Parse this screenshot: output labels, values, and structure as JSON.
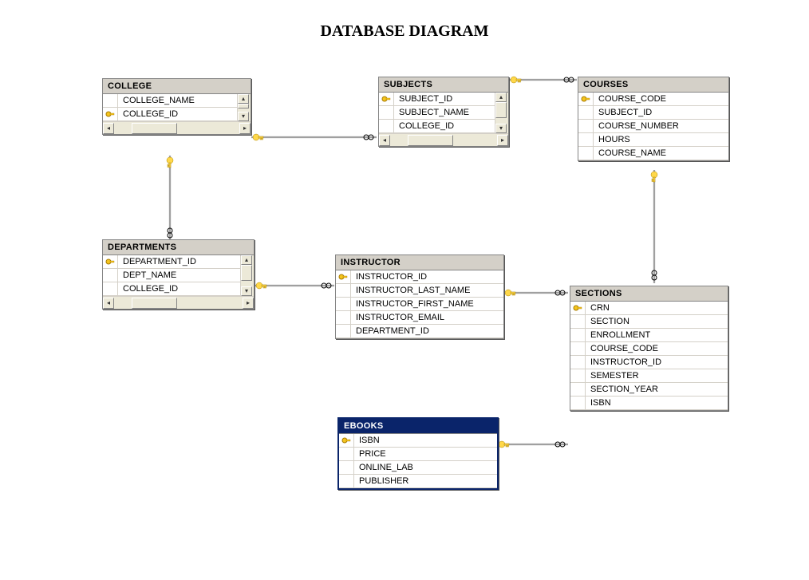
{
  "title": "DATABASE DIAGRAM",
  "tables": {
    "college": {
      "name": "COLLEGE",
      "columns": [
        {
          "name": "COLLEGE_NAME",
          "pk": false
        },
        {
          "name": "COLLEGE_ID",
          "pk": true
        }
      ]
    },
    "subjects": {
      "name": "SUBJECTS",
      "columns": [
        {
          "name": "SUBJECT_ID",
          "pk": true
        },
        {
          "name": "SUBJECT_NAME",
          "pk": false
        },
        {
          "name": "COLLEGE_ID",
          "pk": false
        }
      ]
    },
    "courses": {
      "name": "COURSES",
      "columns": [
        {
          "name": "COURSE_CODE",
          "pk": true
        },
        {
          "name": "SUBJECT_ID",
          "pk": false
        },
        {
          "name": "COURSE_NUMBER",
          "pk": false
        },
        {
          "name": "HOURS",
          "pk": false
        },
        {
          "name": "COURSE_NAME",
          "pk": false
        }
      ]
    },
    "departments": {
      "name": "DEPARTMENTS",
      "columns": [
        {
          "name": "DEPARTMENT_ID",
          "pk": true
        },
        {
          "name": "DEPT_NAME",
          "pk": false
        },
        {
          "name": "COLLEGE_ID",
          "pk": false
        }
      ]
    },
    "instructor": {
      "name": "INSTRUCTOR",
      "columns": [
        {
          "name": "INSTRUCTOR_ID",
          "pk": true
        },
        {
          "name": "INSTRUCTOR_LAST_NAME",
          "pk": false
        },
        {
          "name": "INSTRUCTOR_FIRST_NAME",
          "pk": false
        },
        {
          "name": "INSTRUCTOR_EMAIL",
          "pk": false
        },
        {
          "name": "DEPARTMENT_ID",
          "pk": false
        }
      ]
    },
    "sections": {
      "name": "SECTIONS",
      "columns": [
        {
          "name": "CRN",
          "pk": true
        },
        {
          "name": "SECTION",
          "pk": false
        },
        {
          "name": "ENROLLMENT",
          "pk": false
        },
        {
          "name": "COURSE_CODE",
          "pk": false
        },
        {
          "name": "INSTRUCTOR_ID",
          "pk": false
        },
        {
          "name": "SEMESTER",
          "pk": false
        },
        {
          "name": "SECTION_YEAR",
          "pk": false
        },
        {
          "name": "ISBN",
          "pk": false
        }
      ]
    },
    "ebooks": {
      "name": "EBOOKS",
      "columns": [
        {
          "name": "ISBN",
          "pk": true
        },
        {
          "name": "PRICE",
          "pk": false
        },
        {
          "name": "ONLINE_LAB",
          "pk": false
        },
        {
          "name": "PUBLISHER",
          "pk": false
        }
      ]
    }
  },
  "relationships": [
    {
      "from": "college.COLLEGE_ID",
      "to": "subjects.COLLEGE_ID",
      "type": "one-to-many"
    },
    {
      "from": "subjects.SUBJECT_ID",
      "to": "courses.SUBJECT_ID",
      "type": "one-to-many"
    },
    {
      "from": "college.COLLEGE_ID",
      "to": "departments.COLLEGE_ID",
      "type": "one-to-many"
    },
    {
      "from": "departments.DEPARTMENT_ID",
      "to": "instructor.DEPARTMENT_ID",
      "type": "one-to-many"
    },
    {
      "from": "instructor.INSTRUCTOR_ID",
      "to": "sections.INSTRUCTOR_ID",
      "type": "one-to-many"
    },
    {
      "from": "courses.COURSE_CODE",
      "to": "sections.COURSE_CODE",
      "type": "one-to-many"
    },
    {
      "from": "ebooks.ISBN",
      "to": "sections.ISBN",
      "type": "one-to-many"
    }
  ]
}
